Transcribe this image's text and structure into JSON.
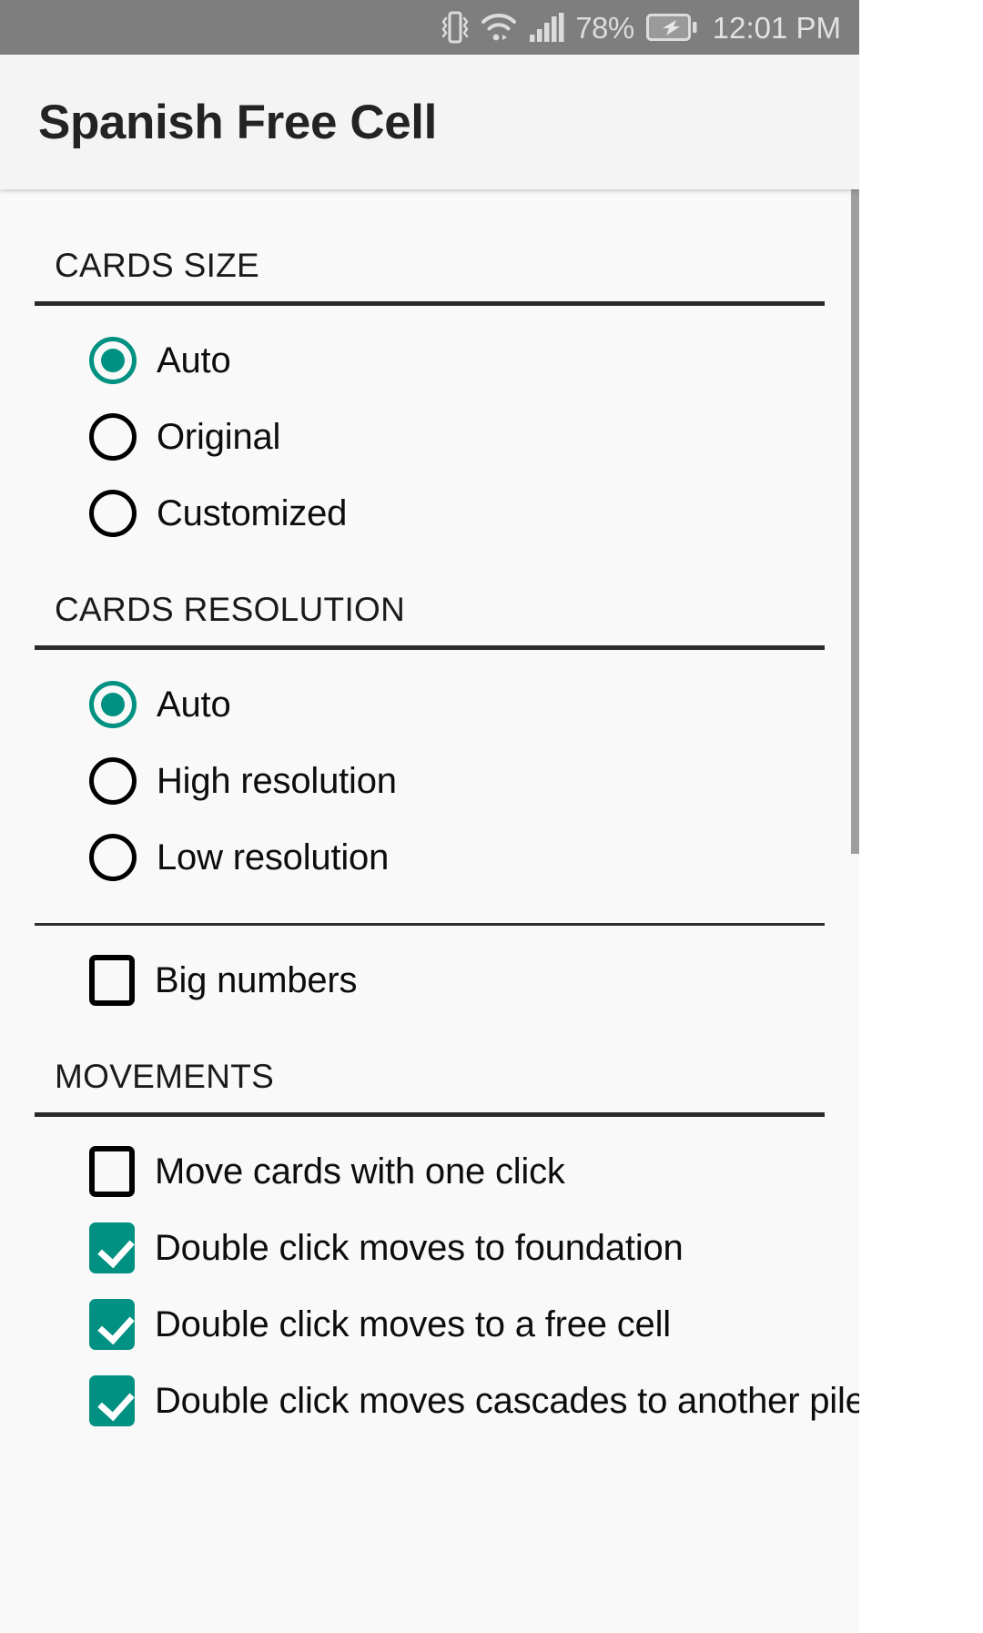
{
  "statusbar": {
    "battery_percent": "78%",
    "clock": "12:01 PM",
    "icons": [
      "vibrate-icon",
      "wifi-icon",
      "signal-icon",
      "battery-charging-icon"
    ]
  },
  "appbar": {
    "title": "Spanish Free Cell"
  },
  "sections": [
    {
      "header": "CARDS SIZE",
      "options": [
        {
          "label": "Auto",
          "control": "radio",
          "checked": true
        },
        {
          "label": "Original",
          "control": "radio",
          "checked": false
        },
        {
          "label": "Customized",
          "control": "radio",
          "checked": false
        }
      ]
    },
    {
      "header": "CARDS RESOLUTION",
      "options": [
        {
          "label": "Auto",
          "control": "radio",
          "checked": true
        },
        {
          "label": "High resolution",
          "control": "radio",
          "checked": false
        },
        {
          "label": "Low resolution",
          "control": "radio",
          "checked": false
        }
      ],
      "extra": [
        {
          "label": "Big numbers",
          "control": "checkbox",
          "checked": false
        }
      ]
    },
    {
      "header": "MOVEMENTS",
      "options": [
        {
          "label": "Move cards with one click",
          "control": "checkbox",
          "checked": false
        },
        {
          "label": "Double click moves to foundation",
          "control": "checkbox",
          "checked": true
        },
        {
          "label": "Double click moves to a free cell",
          "control": "checkbox",
          "checked": true
        },
        {
          "label": "Double click moves cascades to another pile",
          "control": "checkbox",
          "checked": true
        }
      ]
    }
  ],
  "colors": {
    "accent": "#009182",
    "statusbar_bg": "#7e7e7e",
    "appbar_bg": "#f4f4f4",
    "content_bg": "#f9f9f9",
    "rule": "#2b2b2b"
  }
}
